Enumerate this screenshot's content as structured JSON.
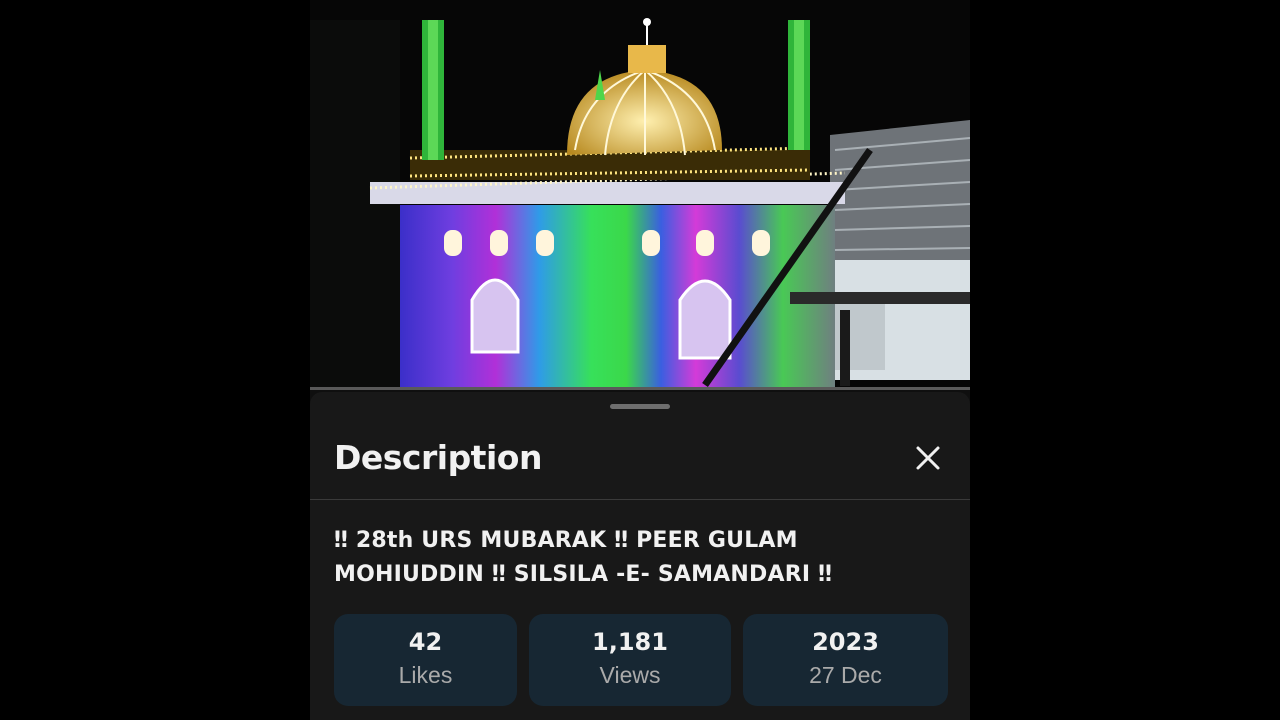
{
  "video": {
    "content": "Illuminated shrine at night"
  },
  "sheet": {
    "title": "Description",
    "description": "‼ 28th URS MUBARAK ‼ PEER GULAM MOHIUDDIN ‼ SILSILA -E- SAMANDARI ‼"
  },
  "stats": {
    "likes_value": "42",
    "likes_label": "Likes",
    "views_value": "1,181",
    "views_label": "Views",
    "year": "2023",
    "date": "27 Dec"
  },
  "colors": {
    "sheet_bg": "#181818",
    "stat_bg": "#172733",
    "text_primary": "#f1f1f1",
    "text_secondary": "#aaaaaa"
  },
  "icons": {
    "close": "close-icon"
  }
}
